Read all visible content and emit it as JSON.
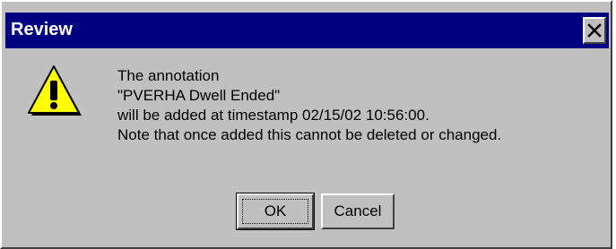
{
  "dialog": {
    "title": "Review",
    "message_lines": [
      "The annotation",
      "\"PVERHA Dwell Ended\"",
      "will be added at timestamp 02/15/02 10:56:00.",
      "Note that once added this cannot be deleted or changed."
    ],
    "icon": "warning-icon",
    "buttons": {
      "ok_label": "OK",
      "cancel_label": "Cancel"
    }
  },
  "colors": {
    "titlebar": "#000080",
    "dialog_background": "#c0c0c0",
    "warning_yellow": "#ffff00"
  }
}
